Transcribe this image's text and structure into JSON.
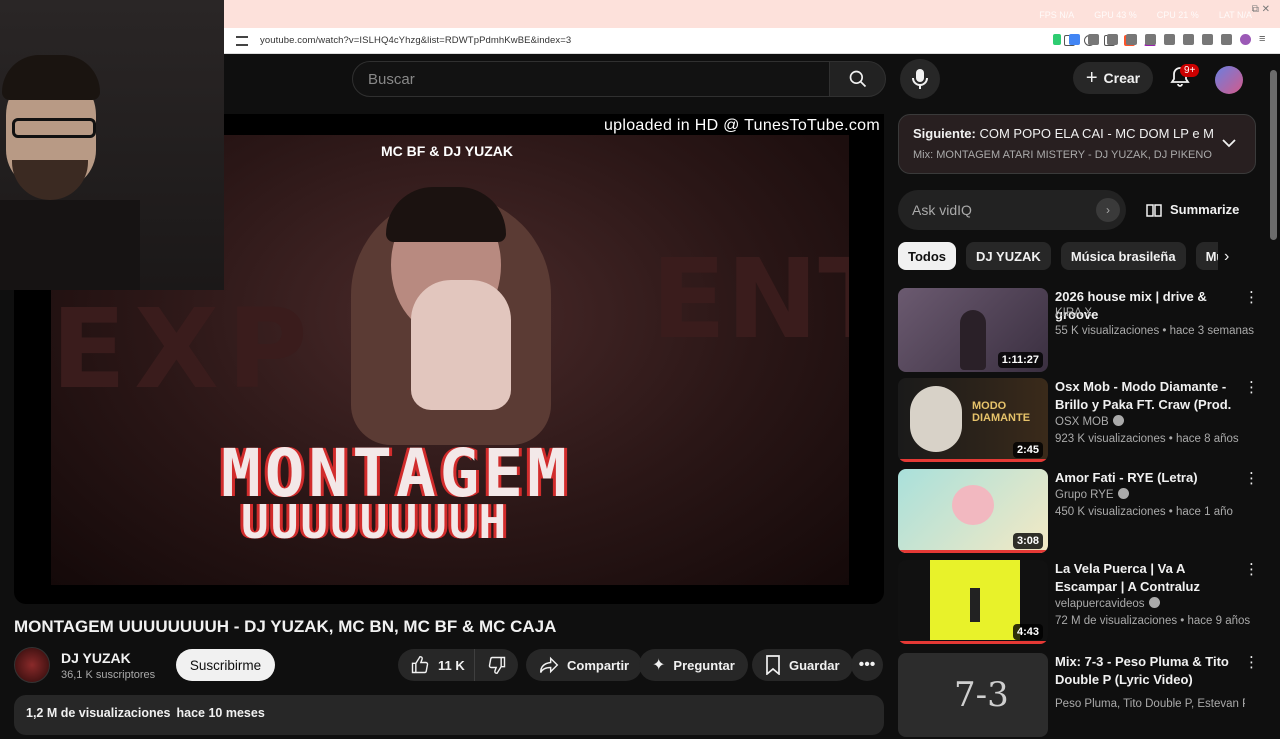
{
  "browser": {
    "url": "youtube.com/watch?v=ISLHQ4cYhzg&list=RDWTpPdmhKwBE&index=3",
    "perf": [
      "FPS N/A",
      "GPU 43 %",
      "CPU 21 %",
      "LAT N/A"
    ]
  },
  "masthead": {
    "search_placeholder": "Buscar",
    "create_label": "Crear",
    "notifications_badge": "9+"
  },
  "video": {
    "artist_overlay": "MC BF & DJ YUZAK",
    "watermark": "uploaded in HD @ TunesToTube.com",
    "art_title": "MONTAGEM",
    "art_subtitle": "UUUUUUUUH",
    "title": "MONTAGEM UUUUUUUUH - DJ YUZAK, MC BN, MC BF & MC CAJA",
    "channel": "DJ YUZAK",
    "subscribers": "36,1 K suscriptores",
    "subscribe_label": "Suscribirme",
    "likes": "11 K",
    "share_label": "Compartir",
    "ask_label": "Preguntar",
    "save_label": "Guardar",
    "views": "1,2 M de visualizaciones",
    "age": "hace 10 meses"
  },
  "sidebar": {
    "up_next_label": "Siguiente:",
    "up_next_title": "COM POPO ELA CAI - MC DOM LP e MC ...",
    "up_next_mix": "Mix: MONTAGEM ATARI MISTERY - DJ YUZAK, DJ PIKENO M...",
    "vidiq_placeholder": "Ask vidIQ",
    "summarize_label": "Summarize",
    "chips": [
      "Todos",
      "DJ YUZAK",
      "Música brasileña",
      "Músi"
    ],
    "recommendations": [
      {
        "title": "2026 house mix | drive & groove",
        "channel": "KIRA X",
        "views": "55 K visualizaciones",
        "age": "hace 3 semanas",
        "duration": "1:11:27",
        "verified": false
      },
      {
        "title": "Osx Mob - Modo Diamante - Brillo y Paka FT. Craw (Prod. ...",
        "channel": "OSX MOB",
        "views": "923 K visualizaciones",
        "age": "hace 8 años",
        "duration": "2:45",
        "verified": true
      },
      {
        "title": "Amor Fati - RYE (Letra)",
        "channel": "Grupo RYE",
        "views": "450 K visualizaciones",
        "age": "hace 1 año",
        "duration": "3:08",
        "verified": true
      },
      {
        "title": "La Vela Puerca | Va A Escampar | A Contraluz",
        "channel": "velapuercavideos",
        "views": "72 M de visualizaciones",
        "age": "hace 9 años",
        "duration": "4:43",
        "verified": true
      },
      {
        "title": "Mix: 7-3 - Peso Pluma & Tito Double P (Lyric Video)",
        "channel": "Peso Pluma, Tito Double P, Estevan Plaz...",
        "views": "",
        "age": "",
        "duration": "",
        "verified": false
      }
    ]
  },
  "colors": {
    "background": "#0f0f0f",
    "accent_red": "#e53935",
    "tab_strip": "#fde1db"
  }
}
